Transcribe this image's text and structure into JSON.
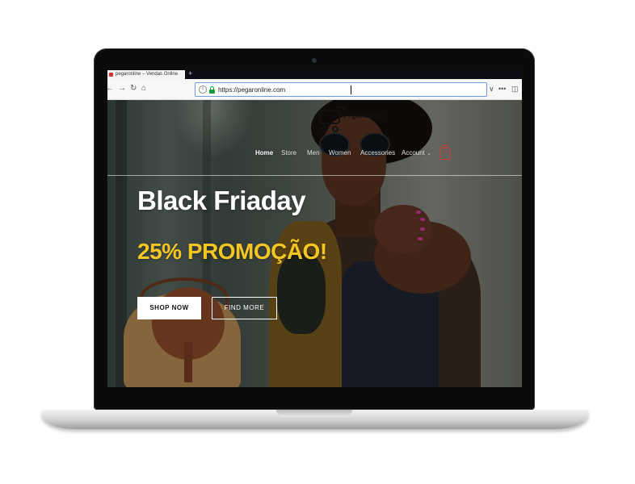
{
  "browser": {
    "tab_title": "pegaronline – Vendas Online",
    "new_tab": "+",
    "back": "←",
    "forward": "→",
    "reload": "↻",
    "home": "⌂",
    "url": "https://pegaronline.com",
    "right_controls": [
      "∨",
      "•••",
      "◫"
    ]
  },
  "site": {
    "logo_text": "Pegaronline",
    "menu": [
      {
        "label": "Home",
        "active": true
      },
      {
        "label": "Store"
      },
      {
        "label": "Men"
      },
      {
        "label": "Women"
      },
      {
        "label": "Accessories"
      },
      {
        "label": "Account"
      }
    ],
    "account_chevron": "⌄",
    "cart_count": "0"
  },
  "hero": {
    "title": "Black Friaday",
    "promo": "25% PROMOÇÃO!",
    "primary_button": "SHOP NOW",
    "secondary_button": "FIND MORE"
  },
  "colors": {
    "promo": "#f3c623",
    "cart": "#d83a3a",
    "nail": "#d2399a"
  }
}
